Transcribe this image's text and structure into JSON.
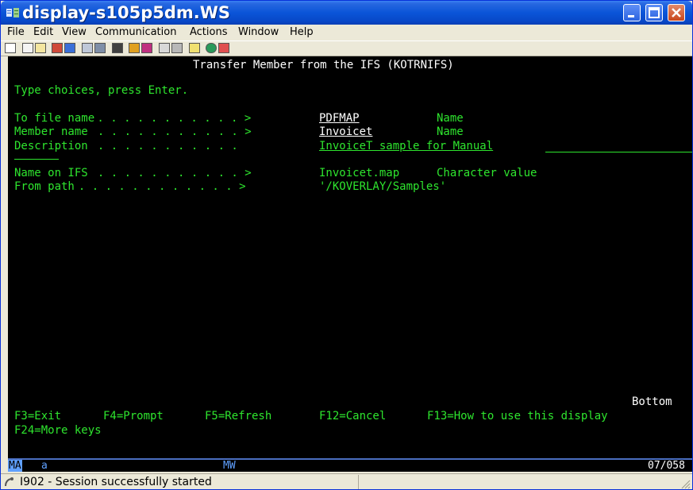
{
  "window": {
    "title": "display-s105p5dm.WS"
  },
  "menu": [
    "File",
    "Edit",
    "View",
    "Communication",
    "Actions",
    "Window",
    "Help"
  ],
  "screen": {
    "heading": "Transfer Member from the IFS (KOTRNIFS)",
    "instruction": "Type choices, press Enter.",
    "fields": [
      {
        "label": "To file name",
        "dots": " . . . . . . . . . . . >",
        "value": "PDFMAP",
        "hint": "Name"
      },
      {
        "label": "Member name",
        "dots": "  . . . . . . . . . . . >",
        "value": "Invoicet",
        "hint": "Name"
      },
      {
        "label": "Description",
        "dots": "  . . . . . . . . . . .",
        "value": "InvoiceT sample for Manual"
      },
      {
        "label": "Name on IFS",
        "dots": "  . . . . . . . . . . . >",
        "value": "Invoicet.map",
        "hint": "Character value"
      },
      {
        "label": "From path",
        "dots": "  . . . . . . . . . . . . >",
        "value": "'/KOVERLAY/Samples'"
      }
    ],
    "more_indicator": "Bottom",
    "function_keys": {
      "f3": "F3=Exit",
      "f4": "F4=Prompt",
      "f5": "F5=Refresh",
      "f12": "F12=Cancel",
      "f13": "F13=How to use this display",
      "f24": "F24=More keys"
    }
  },
  "oia": {
    "ma": "MA",
    "a": "a",
    "mw": "MW",
    "cursor": "07/058"
  },
  "status_message": "I902 - Session successfully started"
}
